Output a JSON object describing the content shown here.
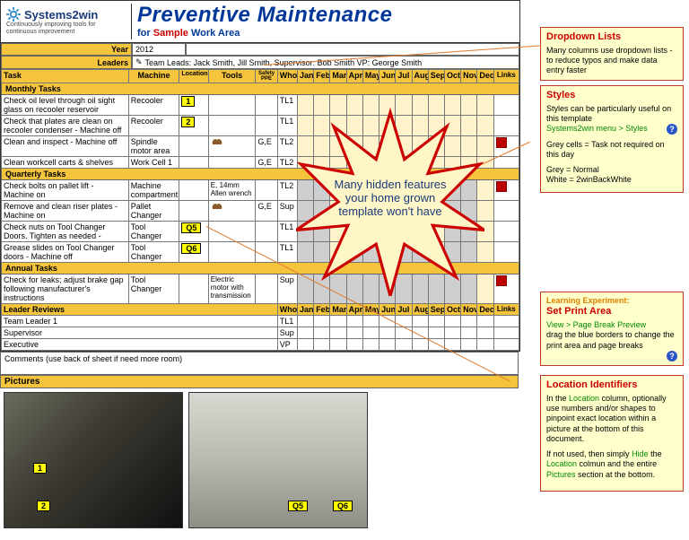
{
  "logo": {
    "brand": "Systems2win",
    "tagline": "Continuously improving tools for continuous improvement"
  },
  "title": {
    "main": "Preventive Maintenance",
    "sub_for": "for",
    "sub_sample": "Sample",
    "sub_area": "Work Area"
  },
  "meta": {
    "year_label": "Year",
    "year_value": "2012",
    "leaders_label": "Leaders",
    "leaders_value": "Team Leads: Jack Smith, Jill Smith, Supervisor: Bob Smith  VP: George Smith"
  },
  "headers": {
    "task": "Task",
    "machine": "Machine",
    "location": "Location",
    "tools": "Tools",
    "safety": "Safety / PPE",
    "who": "Who",
    "months": [
      "Jan",
      "Feb",
      "Mar",
      "Apr",
      "May",
      "Jun",
      "Jul",
      "Aug",
      "Sep",
      "Oct",
      "Nov",
      "Dec"
    ],
    "links": "Links"
  },
  "sections": {
    "monthly": "Monthly Tasks",
    "quarterly": "Quarterly Tasks",
    "annual": "Annual Tasks",
    "leader_reviews": "Leader Reviews",
    "comments": "Comments (use back of sheet if need more room)",
    "pictures": "Pictures"
  },
  "monthly_rows": [
    {
      "task": "Check oil level through oil sight glass on recooler reservoir",
      "machine": "Recooler",
      "loc": "1",
      "tools": "",
      "who": "TL1",
      "link": ""
    },
    {
      "task": "Check that plates are clean on recooler condenser - Machine off",
      "machine": "Recooler",
      "loc": "2",
      "tools": "",
      "who": "TL1",
      "link": ""
    },
    {
      "task": "Clean and  inspect - Machine off",
      "machine": "Spindle motor area",
      "loc": "",
      "tools": "gear",
      "safety": "G,E",
      "who": "TL2",
      "link": "pdf"
    },
    {
      "task": "Clean workcell carts & shelves",
      "machine": "Work Cell 1",
      "loc": "",
      "tools": "",
      "safety": "G,E",
      "who": "TL2",
      "link": ""
    }
  ],
  "quarterly_rows": [
    {
      "task": "Check bolts on pallet lift - Machine on",
      "machine": "Machine compartment",
      "loc": "",
      "tools": "E, 14mm Allen wrench",
      "who": "TL2",
      "link": "pdf"
    },
    {
      "task": "Remove and clean riser plates - Machine on",
      "machine": "Pallet Changer",
      "loc": "",
      "tools": "gear",
      "safety": "G,E",
      "who": "Sup",
      "link": ""
    },
    {
      "task": "Check nuts on Tool Changer Doors. Tighten as needed -",
      "machine": "Tool Changer",
      "loc": "Q5",
      "tools": "",
      "who": "TL1",
      "link": ""
    },
    {
      "task": "Grease slides on Tool Changer doors - Machine off",
      "machine": "Tool Changer",
      "loc": "Q6",
      "tools": "",
      "who": "TL1",
      "link": ""
    }
  ],
  "annual_rows": [
    {
      "task": "Check for leaks; adjust brake gap following manufacturer's instructions",
      "machine": "Tool Changer",
      "loc": "",
      "tools": "Electric motor with transmission",
      "who": "Sup",
      "link": "pdf"
    }
  ],
  "leader_rows": [
    {
      "name": "Team Leader 1",
      "who": "TL1"
    },
    {
      "name": "Supervisor",
      "who": "Sup"
    },
    {
      "name": "Executive",
      "who": "VP"
    }
  ],
  "burst_text": "Many hidden features your home grown template won't have",
  "callouts": {
    "dropdown": {
      "title": "Dropdown Lists",
      "body": "Many columns use dropdown lists - to reduce typos and make data entry faster"
    },
    "styles": {
      "title": "Styles",
      "l1": "Styles can be particularly useful on this template",
      "l2": "Systems2win menu > Styles",
      "l3": "Grey cells = Task not required on this day",
      "l4": "Grey = Normal",
      "l5": "White = 2winBackWhite"
    },
    "print": {
      "title": "Learning Experiment:",
      "sub": "Set Print Area",
      "l1": "View > Page Break Preview",
      "l2": "drag the blue borders to change the print area and page breaks"
    },
    "location": {
      "title": "Location Identifiers",
      "p1a": "In the ",
      "p1b": "Location",
      "p1c": " column, optionally use numbers and/or shapes to pinpoint exact location within a picture at the bottom of this document.",
      "p2a": "If not used, then simply ",
      "p2b": "Hide",
      "p2c": " the ",
      "p2d": "Location",
      "p2e": " colmun and the entire ",
      "p2f": "Pictures",
      "p2g": " section at the bottom."
    }
  },
  "photo_tags": {
    "p1a": "1",
    "p1b": "2",
    "p2a": "Q5",
    "p2b": "Q6"
  }
}
